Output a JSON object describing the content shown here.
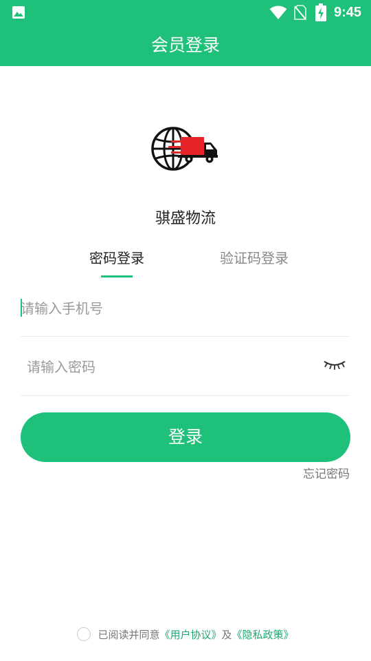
{
  "status_bar": {
    "time": "9:45",
    "color": "#1fc07a"
  },
  "app_bar": {
    "title": "会员登录"
  },
  "brand": {
    "name": "骐盛物流",
    "logo_icon": "globe-truck-logo"
  },
  "tabs": [
    {
      "label": "密码登录",
      "active": true
    },
    {
      "label": "验证码登录",
      "active": false
    }
  ],
  "form": {
    "phone": {
      "value": "",
      "placeholder": "请输入手机号"
    },
    "password": {
      "value": "",
      "placeholder": "请输入密码",
      "toggle_icon": "eye-closed-icon"
    },
    "submit_label": "登录",
    "forgot_label": "忘记密码"
  },
  "agreement": {
    "checked": false,
    "prefix": "已阅读并同意",
    "user_agreement": "《用户协议》",
    "conjunction": "及",
    "privacy_policy": "《隐私政策》"
  },
  "colors": {
    "accent": "#1fc07a",
    "link": "#1fa870",
    "logo_red": "#e8232a"
  }
}
